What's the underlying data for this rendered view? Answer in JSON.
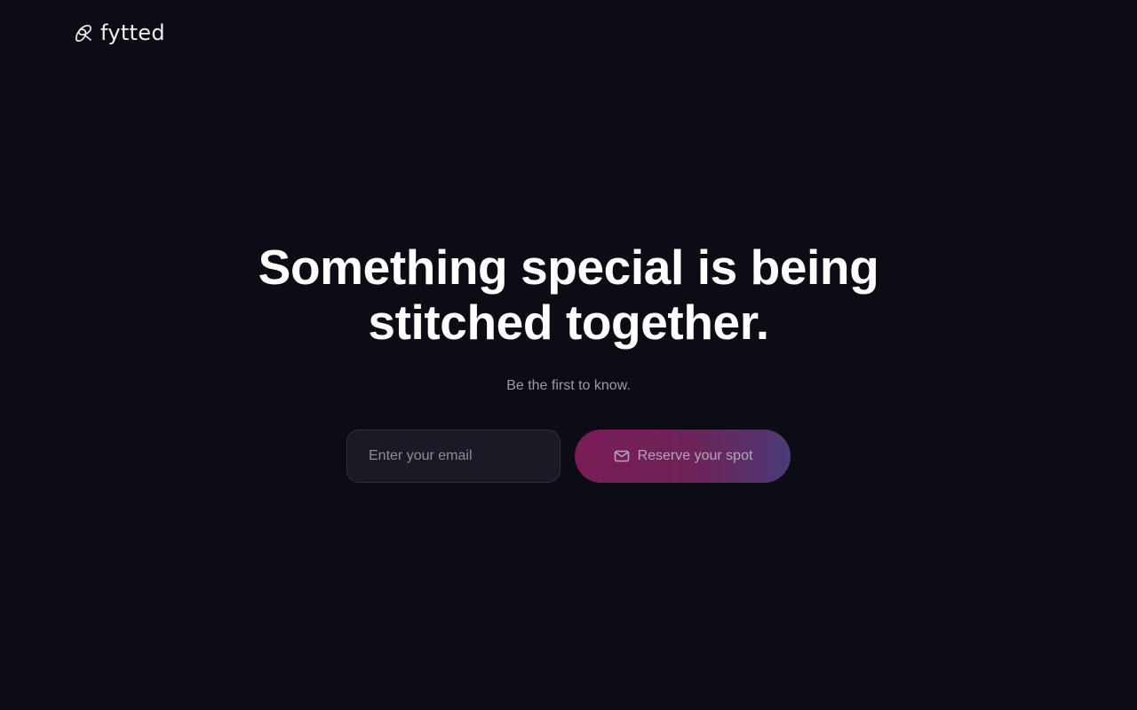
{
  "header": {
    "logo_text": "fytted",
    "logo_icon": "stitch-loop-icon"
  },
  "hero": {
    "headline_line1": "Something special is being",
    "headline_line2": "stitched together.",
    "subtitle": "Be the first to know."
  },
  "signup": {
    "email_placeholder": "Enter your email",
    "email_value": "",
    "button_label": "Reserve your spot",
    "button_icon": "mail-icon"
  },
  "colors": {
    "background": "#0c0c14",
    "button_gradient_start": "#7a1c55",
    "button_gradient_end": "#4b3a76",
    "input_background": "#1a1a24"
  }
}
